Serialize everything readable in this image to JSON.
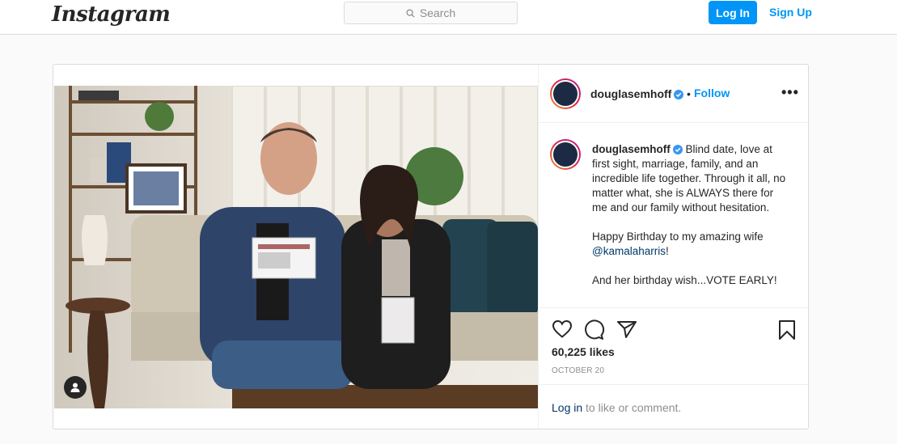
{
  "header": {
    "logo_text": "Instagram",
    "search_placeholder": "Search",
    "login_label": "Log In",
    "signup_label": "Sign Up"
  },
  "post": {
    "username": "douglasemhoff",
    "follow_label": "Follow",
    "follow_separator": "•",
    "more_label": "•••",
    "caption_user": "douglasemhoff",
    "caption_part1": "Blind date, love at first sight, marriage, family, and an incredible life together. Through it all, no matter what, she is ALWAYS there for me and our family without hesitation.\n\nHappy Birthday to my amazing wife ",
    "caption_mention": "@kamalaharris",
    "caption_part2": "!\n\nAnd her birthday wish...VOTE EARLY!",
    "likes": "60,225 likes",
    "date": "OCTOBER 20",
    "comment_login": "Log in",
    "comment_rest": " to like or comment."
  },
  "icons": {
    "search": "search-icon",
    "verified": "verified-badge-icon",
    "like": "heart-icon",
    "comment": "comment-icon",
    "share": "send-icon",
    "save": "bookmark-icon",
    "tag": "user-tag-icon"
  },
  "colors": {
    "accent": "#0095f6",
    "link_dark": "#00376b",
    "muted": "#8e8e8e",
    "border": "#dbdbdb"
  }
}
